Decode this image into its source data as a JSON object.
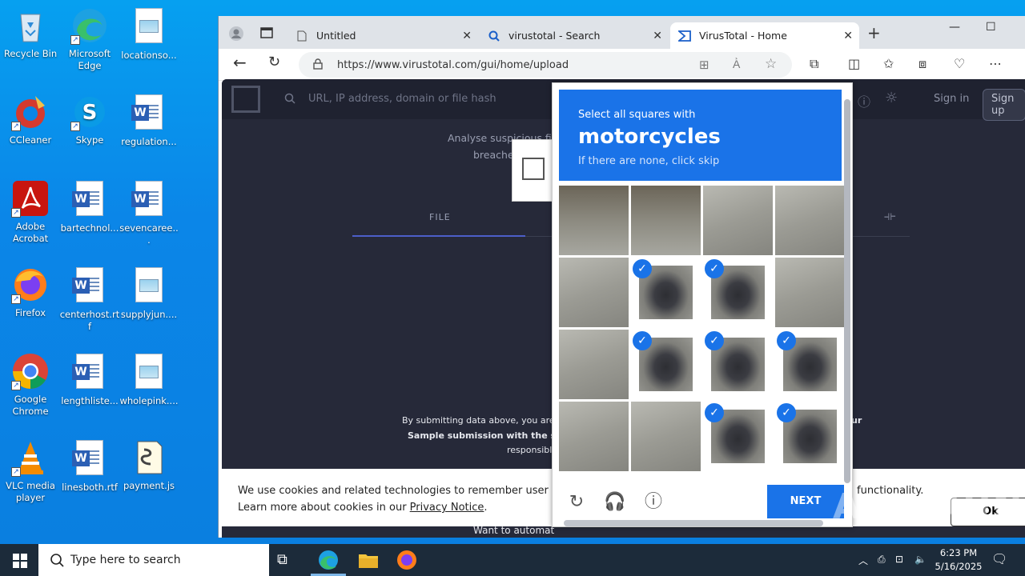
{
  "desktop": {
    "icons": [
      {
        "label": "Recycle Bin"
      },
      {
        "label": "Microsoft Edge"
      },
      {
        "label": "locationso..."
      },
      {
        "label": "CCleaner"
      },
      {
        "label": "Skype"
      },
      {
        "label": "regulation..."
      },
      {
        "label": "Adobe Acrobat"
      },
      {
        "label": "bartechnol..."
      },
      {
        "label": "sevencaree..."
      },
      {
        "label": "Firefox"
      },
      {
        "label": "centerhost.rtf"
      },
      {
        "label": "supplyjun...."
      },
      {
        "label": "Google Chrome"
      },
      {
        "label": "lengthliste..."
      },
      {
        "label": "wholepink...."
      },
      {
        "label": "VLC media player"
      },
      {
        "label": "linesboth.rtf"
      },
      {
        "label": "payment.js"
      }
    ]
  },
  "browser": {
    "tabs": [
      {
        "label": "Untitled"
      },
      {
        "label": "virustotal - Search"
      },
      {
        "label": "VirusTotal - Home"
      }
    ],
    "url": "https://www.virustotal.com/gui/home/upload"
  },
  "vt": {
    "search_placeholder": "URL, IP address, domain or file hash",
    "sign_in": "Sign in",
    "sign_up": "Sign up",
    "analyse_text": "Analyse suspicious fil",
    "breach_text": "breache",
    "tab_file": "FILE",
    "submit_text": "By submitting data above, you are ag",
    "sample_text": "Sample submission with the secur",
    "responsible_text": "responsibl",
    "right_text_r": "ur",
    "automate_text": "Want to automat"
  },
  "cookie": {
    "line1": "We use cookies and related technologies to remember user prefer",
    "line1_right": "functionality.",
    "line2_prefix": "Learn more about cookies in our ",
    "line2_link": "Privacy Notice",
    "line2_suffix": ".",
    "ok": "Ok"
  },
  "captcha": {
    "instruction": "Select all squares with",
    "target": "motorcycles",
    "hint": "If there are none, click skip",
    "next": "NEXT",
    "cells": [
      {
        "kind": "tree",
        "selected": false
      },
      {
        "kind": "tree",
        "selected": false
      },
      {
        "kind": "road",
        "selected": false
      },
      {
        "kind": "road",
        "selected": false
      },
      {
        "kind": "road",
        "selected": false
      },
      {
        "kind": "bike",
        "selected": true
      },
      {
        "kind": "bike",
        "selected": true
      },
      {
        "kind": "road",
        "selected": false
      },
      {
        "kind": "road",
        "selected": false
      },
      {
        "kind": "bike",
        "selected": true
      },
      {
        "kind": "bike",
        "selected": true
      },
      {
        "kind": "bike",
        "selected": true
      },
      {
        "kind": "road",
        "selected": false
      },
      {
        "kind": "road",
        "selected": false
      },
      {
        "kind": "bike",
        "selected": true
      },
      {
        "kind": "bike",
        "selected": true
      }
    ]
  },
  "watermark": "ANY RUN",
  "taskbar": {
    "search_placeholder": "Type here to search",
    "time": "6:23 PM",
    "date": "5/16/2025"
  },
  "colors": {
    "captcha_blue": "#1a73e8",
    "vt_bg": "#262939"
  }
}
